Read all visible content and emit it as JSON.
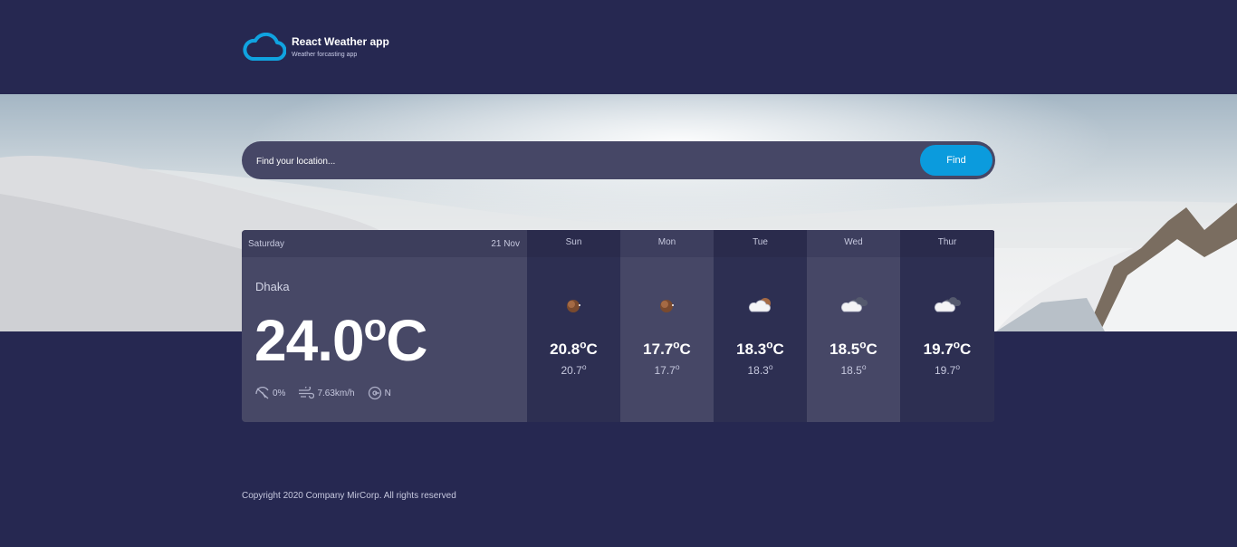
{
  "app": {
    "title": "React Weather app",
    "subtitle": "Weather forcasting app"
  },
  "search": {
    "placeholder": "Find your location...",
    "button_label": "Find"
  },
  "today": {
    "day": "Saturday",
    "date": "21 Nov",
    "city": "Dhaka",
    "temp": "24.0",
    "unit": "C",
    "degree": "o",
    "precipitation": "0%",
    "wind": "7.63km/h",
    "direction": "N"
  },
  "forecast": [
    {
      "day": "Sun",
      "temp": "20.8",
      "unit": "C",
      "low": "20.7",
      "icon": "moon-icon"
    },
    {
      "day": "Mon",
      "temp": "17.7",
      "unit": "C",
      "low": "17.7",
      "icon": "moon-icon"
    },
    {
      "day": "Tue",
      "temp": "18.3",
      "unit": "C",
      "low": "18.3",
      "icon": "cloud-moon-icon"
    },
    {
      "day": "Wed",
      "temp": "18.5",
      "unit": "C",
      "low": "18.5",
      "icon": "cloudy-icon"
    },
    {
      "day": "Thur",
      "temp": "19.7",
      "unit": "C",
      "low": "19.7",
      "icon": "cloudy-icon"
    }
  ],
  "degree_symbol": "o",
  "footer": {
    "text": "Copyright 2020 Company MirCorp. All rights reserved"
  },
  "colors": {
    "background": "#262851",
    "accent": "#0b9bdd",
    "panel": "#464766"
  }
}
